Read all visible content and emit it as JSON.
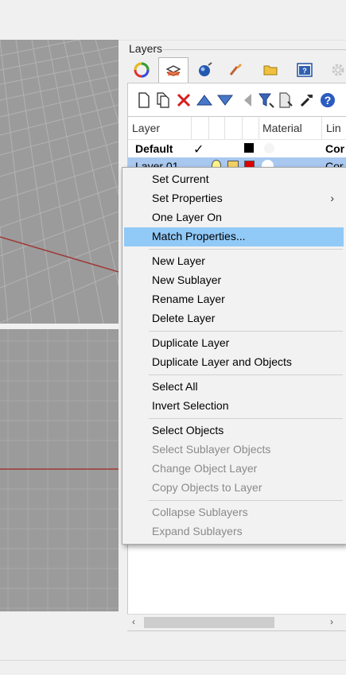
{
  "panel": {
    "title": "Layers",
    "tabs": [
      "color-wheel-icon",
      "layers-icon",
      "render-sphere-icon",
      "brush-icon",
      "folder-icon",
      "help-box-icon",
      "gear-icon"
    ],
    "toolbar": [
      "new-layer-icon",
      "new-sublayer-icon",
      "delete-icon",
      "move-up-icon",
      "move-down-icon",
      "move-out-icon",
      "filter-icon",
      "properties-icon",
      "tools-icon",
      "help-icon"
    ]
  },
  "layer_list": {
    "columns": {
      "layer": "Layer",
      "material": "Material",
      "linetype": "Lin"
    },
    "rows": [
      {
        "name": "Default",
        "current": "✓",
        "color": "#000000",
        "linetype": "Cor"
      },
      {
        "name": "Layer 01",
        "color": "#e00000",
        "linetype": "Cor"
      }
    ]
  },
  "context_menu": {
    "items": [
      {
        "label": "Set Current",
        "enabled": true
      },
      {
        "label": "Set Properties",
        "enabled": true,
        "submenu": "›"
      },
      {
        "label": "One Layer On",
        "enabled": true
      },
      {
        "label": "Match Properties...",
        "enabled": true,
        "highlighted": true
      },
      {
        "label": "New Layer",
        "enabled": true
      },
      {
        "label": "New Sublayer",
        "enabled": true
      },
      {
        "label": "Rename Layer",
        "enabled": true
      },
      {
        "label": "Delete Layer",
        "enabled": true
      },
      {
        "label": "Duplicate Layer",
        "enabled": true
      },
      {
        "label": "Duplicate Layer and Objects",
        "enabled": true
      },
      {
        "label": "Select All",
        "enabled": true
      },
      {
        "label": "Invert Selection",
        "enabled": true
      },
      {
        "label": "Select Objects",
        "enabled": true
      },
      {
        "label": "Select Sublayer Objects",
        "enabled": false
      },
      {
        "label": "Change Object Layer",
        "enabled": false
      },
      {
        "label": "Copy Objects to Layer",
        "enabled": false
      },
      {
        "label": "Collapse Sublayers",
        "enabled": false
      },
      {
        "label": "Expand Sublayers",
        "enabled": false
      }
    ]
  },
  "scrollbar": {
    "left": "‹",
    "right": "›"
  }
}
